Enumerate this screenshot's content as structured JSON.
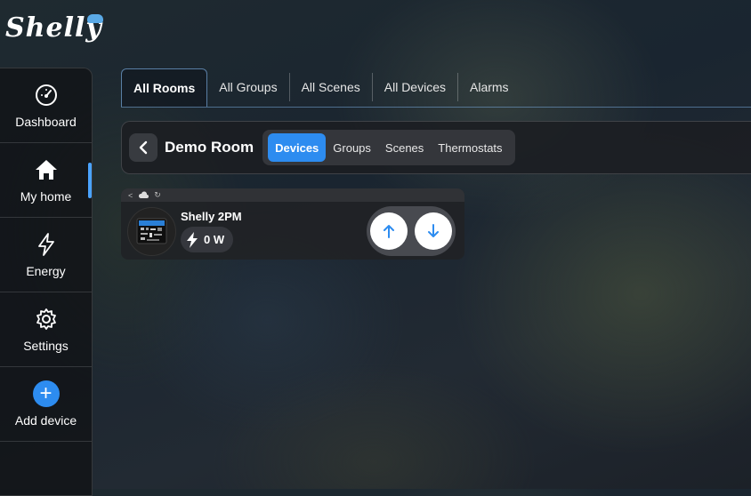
{
  "brand": {
    "logo_text": "Shelly"
  },
  "sidebar": {
    "items": [
      {
        "label": "Dashboard",
        "icon": "gauge-icon"
      },
      {
        "label": "My home",
        "icon": "home-icon",
        "active": true
      },
      {
        "label": "Energy",
        "icon": "lightning-icon"
      },
      {
        "label": "Settings",
        "icon": "gear-icon"
      },
      {
        "label": "Add device",
        "icon": "plus-icon"
      }
    ]
  },
  "tabs": {
    "items": [
      {
        "label": "All Rooms",
        "active": true
      },
      {
        "label": "All Groups"
      },
      {
        "label": "All Scenes"
      },
      {
        "label": "All Devices"
      },
      {
        "label": "Alarms"
      }
    ]
  },
  "room": {
    "title": "Demo Room",
    "subtabs": [
      {
        "label": "Devices",
        "active": true
      },
      {
        "label": "Groups"
      },
      {
        "label": "Scenes"
      },
      {
        "label": "Thermostats"
      }
    ]
  },
  "device": {
    "name": "Shelly 2PM",
    "power": "0 W"
  },
  "colors": {
    "accent": "#2d8cf0",
    "sidebar_bg": "#121418",
    "card_bg": "#202226"
  }
}
